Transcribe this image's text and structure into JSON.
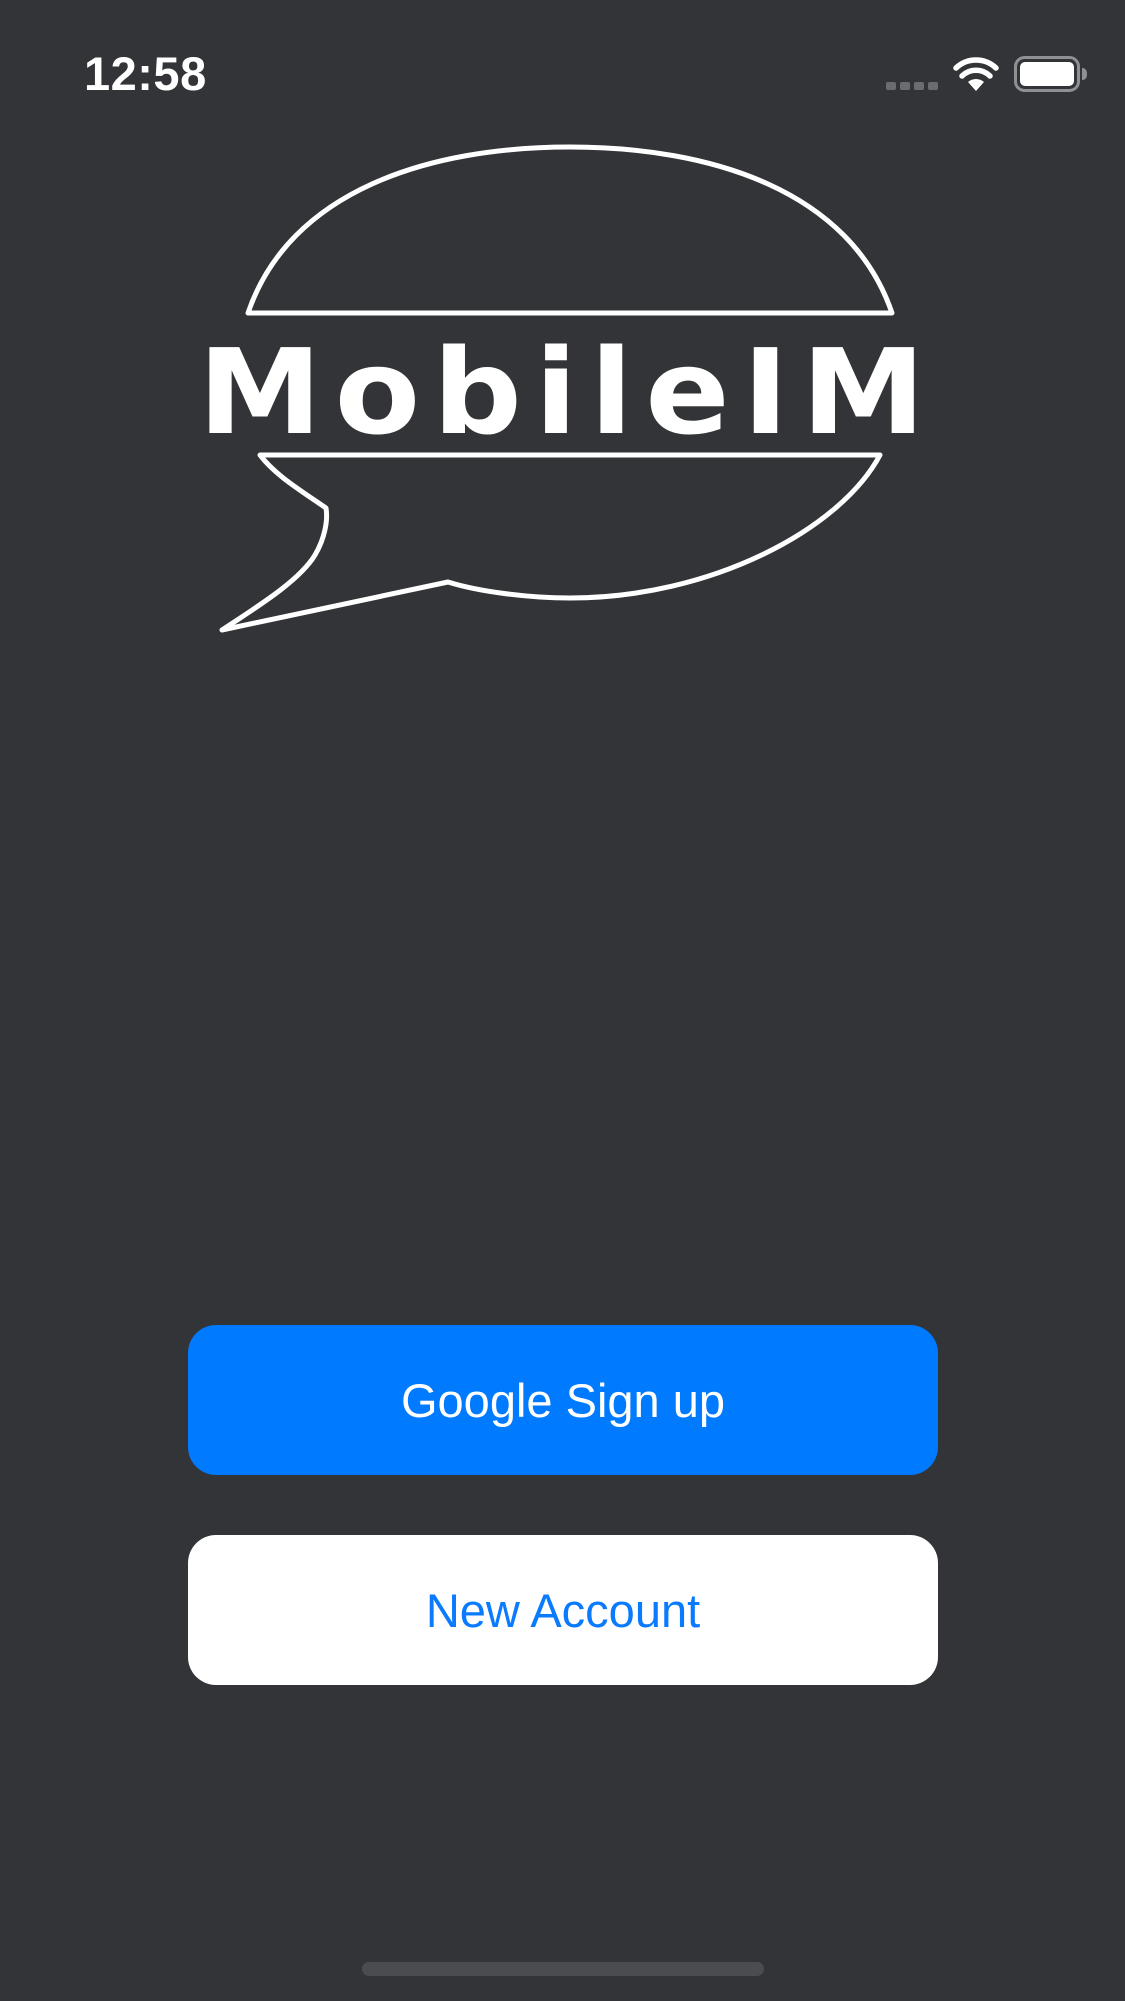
{
  "status_bar": {
    "time": "12:58"
  },
  "logo": {
    "text": "MobileIM"
  },
  "buttons": {
    "google_signup": "Google Sign up",
    "new_account": "New Account"
  },
  "colors": {
    "background": "#323437",
    "primary": "#007aff",
    "secondary_bg": "#ffffff"
  }
}
